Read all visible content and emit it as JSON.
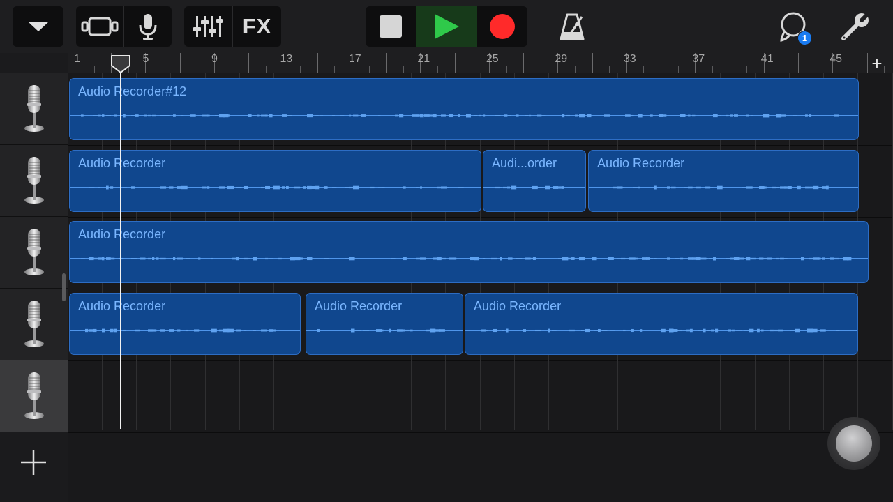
{
  "toolbar": {
    "menu_icon": "triangle-down-icon",
    "tracks_view_icon": "tracks-view-icon",
    "instrument_icon": "microphone-icon",
    "mixer_icon": "mixer-sliders-icon",
    "fx_label": "FX",
    "stop_icon": "stop-icon",
    "play_icon": "play-icon",
    "record_icon": "record-icon",
    "metronome_icon": "metronome-icon",
    "loop_icon": "loop-browser-icon",
    "loop_badge": "1",
    "settings_icon": "wrench-icon",
    "colors": {
      "play": "#2fc94a",
      "record": "#ff2a2a",
      "badge": "#1a7cf2"
    }
  },
  "ruler": {
    "labels": [
      "1",
      "5",
      "9",
      "13",
      "17",
      "21",
      "25",
      "29",
      "33",
      "37",
      "41",
      "45"
    ],
    "add_label": "+"
  },
  "tracks": [
    {
      "instrument": "Audio Recorder",
      "regions": [
        {
          "name": "Audio Recorder#12"
        }
      ]
    },
    {
      "instrument": "Audio Recorder",
      "regions": [
        {
          "name": "Audio Recorder"
        },
        {
          "name": "Audi...order"
        },
        {
          "name": "Audio Recorder"
        }
      ]
    },
    {
      "instrument": "Audio Recorder",
      "regions": [
        {
          "name": "Audio Recorder"
        }
      ]
    },
    {
      "instrument": "Audio Recorder",
      "regions": [
        {
          "name": "Audio Recorder"
        },
        {
          "name": "Audio Recorder"
        },
        {
          "name": "Audio Recorder"
        }
      ]
    },
    {
      "instrument": "Audio Recorder",
      "regions": []
    }
  ],
  "add_track_label": "+",
  "colors": {
    "region": "#10478e",
    "region_text": "#7ab6ff",
    "waveform": "#4f95ea"
  }
}
